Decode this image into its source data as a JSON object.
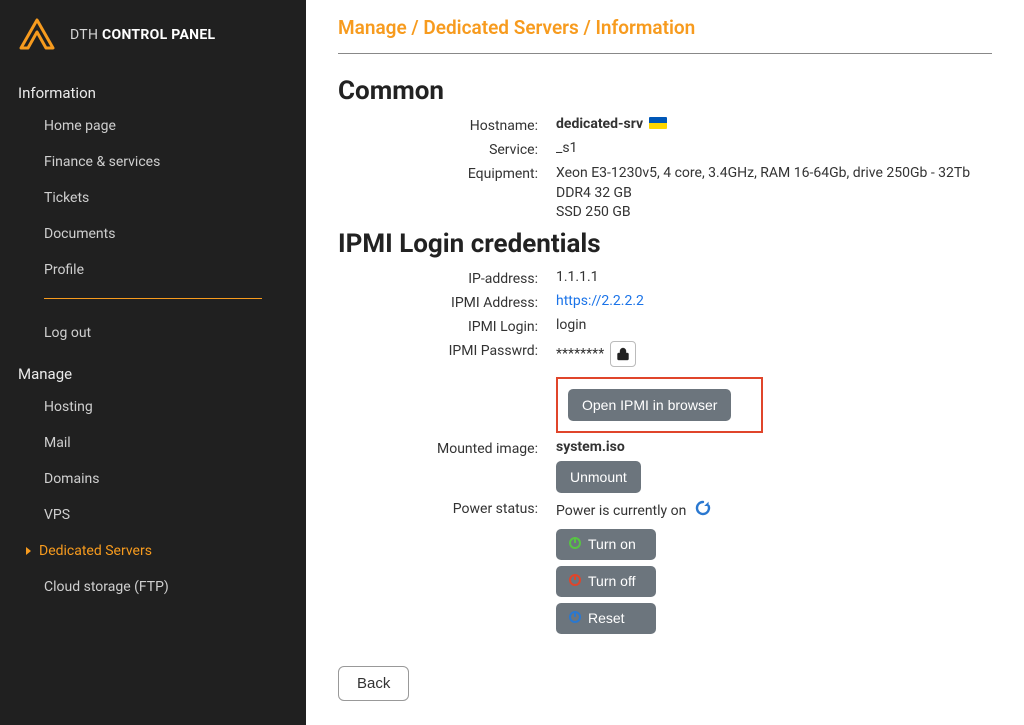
{
  "brand": {
    "prefix": "DTH ",
    "strong": "CONTROL PANEL"
  },
  "sidebar": {
    "sections": {
      "info": {
        "title": "Information",
        "items": [
          {
            "label": "Home page"
          },
          {
            "label": "Finance & services"
          },
          {
            "label": "Tickets"
          },
          {
            "label": "Documents"
          },
          {
            "label": "Profile"
          }
        ]
      },
      "logout": {
        "label": "Log out"
      },
      "manage": {
        "title": "Manage",
        "items": [
          {
            "label": "Hosting"
          },
          {
            "label": "Mail"
          },
          {
            "label": "Domains"
          },
          {
            "label": "VPS"
          },
          {
            "label": "Dedicated Servers"
          },
          {
            "label": "Cloud storage (FTP)"
          }
        ]
      }
    }
  },
  "breadcrumb": "Manage / Dedicated Servers / Information",
  "section_common": "Common",
  "common": {
    "hostname_label": "Hostname:",
    "hostname_value": "dedicated-srv",
    "service_label": "Service:",
    "service_value": "_s1",
    "equipment_label": "Equipment:",
    "equipment_value": "Xeon E3-1230v5, 4 core, 3.4GHz, RAM 16-64Gb, drive 250Gb - 32Tb\nDDR4 32 GB\nSSD 250 GB"
  },
  "section_ipmi": "IPMI Login credentials",
  "ipmi": {
    "ip_label": "IP-address:",
    "ip_value": "1.1.1.1",
    "addr_label": "IPMI Address:",
    "addr_value": "https://2.2.2.2",
    "login_label": "IPMI Login:",
    "login_value": "login",
    "pw_label": "IPMI Passwrd:",
    "pw_value": "********",
    "open_button": "Open IPMI in browser",
    "mounted_label": "Mounted image:",
    "mounted_value": "system.iso",
    "unmount_button": "Unmount",
    "power_label": "Power status:",
    "power_value": "Power is currently on",
    "turn_on": "Turn on",
    "turn_off": "Turn off",
    "reset": "Reset"
  },
  "back_button": "Back"
}
